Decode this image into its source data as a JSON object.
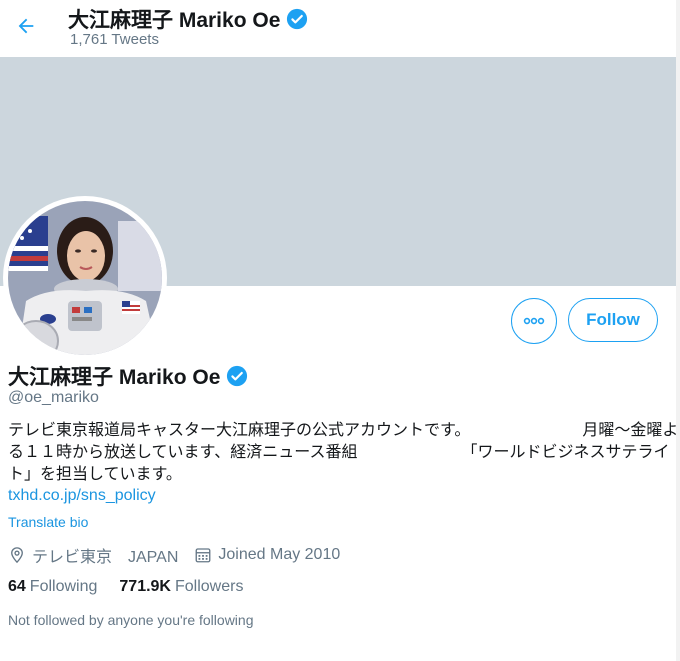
{
  "header": {
    "title": "大江麻理子 Mariko Oe",
    "tweet_count": "1,761 Tweets"
  },
  "profile": {
    "name": "大江麻理子 Mariko Oe",
    "handle": "@oe_mariko",
    "bio_lines": [
      [
        "テレビ東京報道局キャスター大江麻理子の公式アカウントです。",
        "月曜〜金曜よ"
      ],
      [
        "る１１時から放送しています、経済ニュース番組",
        "「ワールドビジネスサテライ"
      ],
      [
        "ト」を担当しています。",
        ""
      ]
    ],
    "link": "txhd.co.jp/sns_policy",
    "translate": "Translate bio",
    "location": "テレビ東京　JAPAN",
    "joined": "Joined May 2010",
    "following_count": "64",
    "following_label": "Following",
    "followers_count": "771.9K",
    "followers_label": "Followers",
    "not_followed": "Not followed by anyone you're following"
  },
  "buttons": {
    "follow": "Follow"
  },
  "colors": {
    "accent": "#1da1f2",
    "banner": "#ccd6dd",
    "muted": "#657786"
  },
  "icons": [
    "back-arrow-icon",
    "verified-badge-icon",
    "more-icon",
    "location-icon",
    "calendar-icon"
  ]
}
